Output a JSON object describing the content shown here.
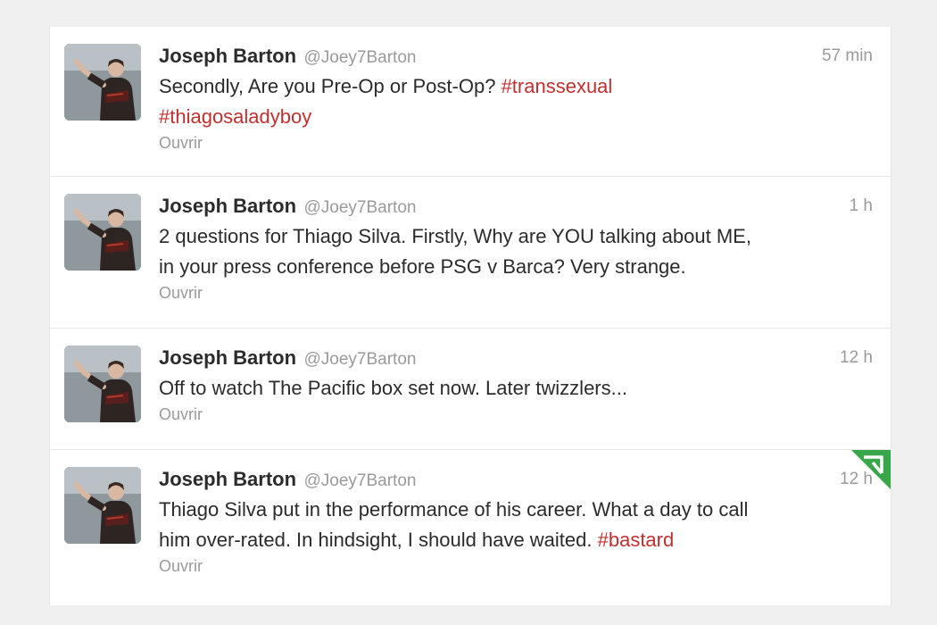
{
  "tweets": [
    {
      "author": "Joseph Barton",
      "handle": "@Joey7Barton",
      "time": "57 min",
      "text_plain": "Secondly, Are you Pre-Op or Post-Op? ",
      "hashtag_1": "#transsexual",
      "hashtag_2": "#thiagosaladyboy",
      "open_label": "Ouvrir"
    },
    {
      "author": "Joseph Barton",
      "handle": "@Joey7Barton",
      "time": "1 h",
      "line_1": "2 questions for Thiago Silva. Firstly, Why are YOU talking about ME,",
      "line_2": "in your press conference before PSG v Barca? Very strange.",
      "open_label": "Ouvrir"
    },
    {
      "author": "Joseph Barton",
      "handle": "@Joey7Barton",
      "time": "12 h",
      "line_1": "Off to watch The Pacific box set now. Later twizzlers...",
      "open_label": "Ouvrir"
    },
    {
      "author": "Joseph Barton",
      "handle": "@Joey7Barton",
      "time": "12 h",
      "line_1": "Thiago Silva put in the performance of his career. What a day to call",
      "line_2": "him over-rated. In hindsight, I should have waited. ",
      "hashtag_1": "#bastard",
      "open_label": "Ouvrir"
    }
  ],
  "colors": {
    "hashtag": "#c0302e",
    "retweet_flag": "#3aa64a"
  },
  "icons": {
    "avatar": "player-photo-avatar",
    "flag": "retweet-corner-icon"
  }
}
